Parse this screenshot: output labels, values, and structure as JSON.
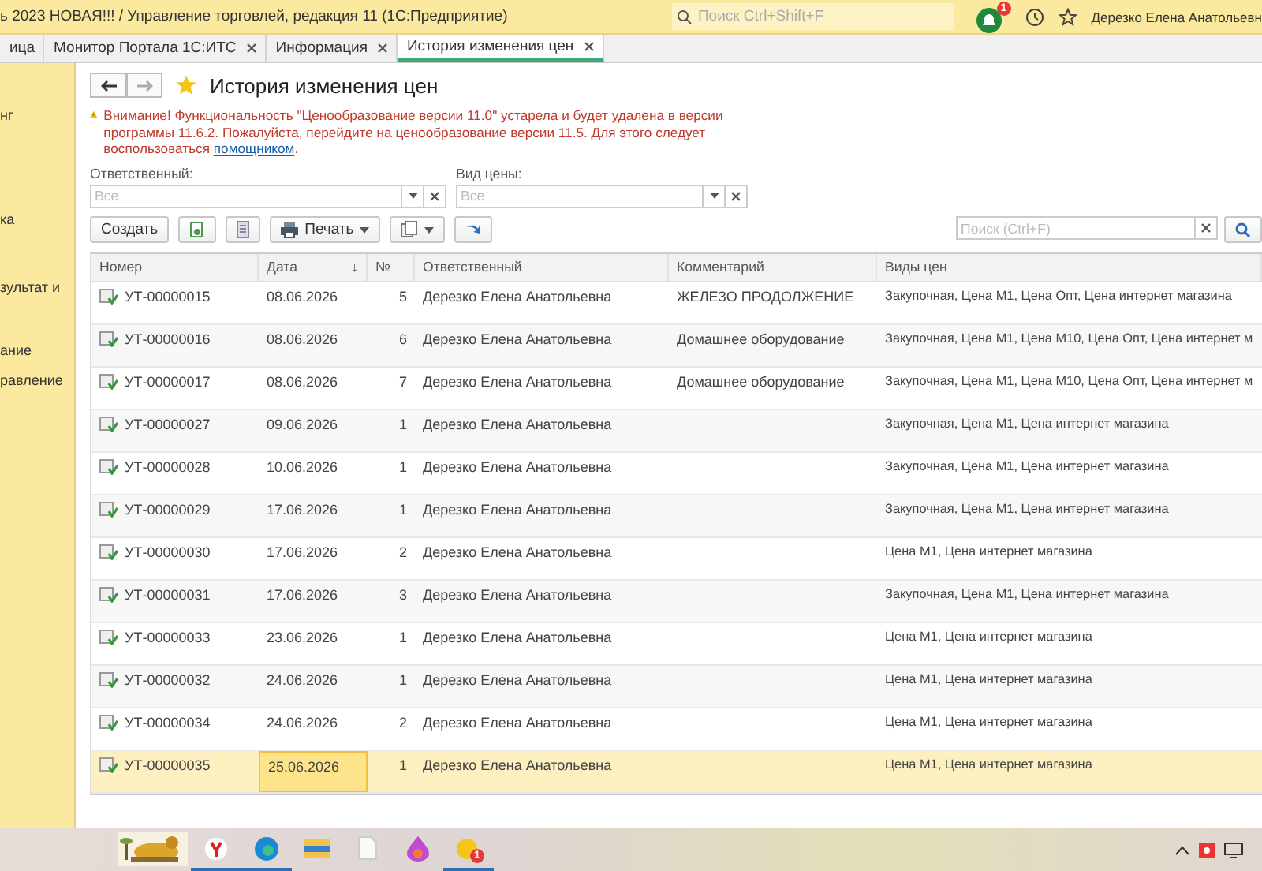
{
  "window": {
    "title": "ь 2023 НОВАЯ!!! / Управление торговлей, редакция 11  (1С:Предприятие)",
    "search_placeholder": "Поиск Ctrl+Shift+F",
    "notifications": "1",
    "user": "Дерезко Елена Анатольевн"
  },
  "tabs": [
    {
      "label": "ица",
      "closable": false,
      "selected": false
    },
    {
      "label": "Монитор Портала 1С:ИТС",
      "closable": true,
      "selected": false
    },
    {
      "label": "Информация",
      "closable": true,
      "selected": false
    },
    {
      "label": "История изменения цен",
      "closable": true,
      "selected": true
    }
  ],
  "sidebar": {
    "items": [
      "нг",
      "ка",
      "зультат и",
      "ание",
      "равление"
    ]
  },
  "page": {
    "title": "История изменения цен",
    "warning": "Внимание! Функциональность \"Ценообразование версии 11.0\" устарела и будет удалена в версии программы 11.6.2. Пожалуйста, перейдите на ценообразование версии 11.5. Для этого следует воспользоваться ",
    "warning_link": "помощником",
    "warning_end": "."
  },
  "filters": [
    {
      "label": "Ответственный:",
      "placeholder": "Все"
    },
    {
      "label": "Вид цены:",
      "placeholder": "Все"
    }
  ],
  "toolbar": {
    "create": "Создать",
    "print": "Печать",
    "search_placeholder": "Поиск (Ctrl+F)"
  },
  "table": {
    "columns": [
      {
        "label": "Номер"
      },
      {
        "label": "Дата",
        "sort_mark": "↓"
      },
      {
        "label": "№"
      },
      {
        "label": "Ответственный"
      },
      {
        "label": "Комментарий"
      },
      {
        "label": "Виды цен"
      }
    ],
    "rows": [
      {
        "number": "УТ-00000015",
        "date": "08.06.2026",
        "n": "5",
        "responsible": "Дерезко Елена Анатольевна",
        "comment": "ЖЕЛЕЗО ПРОДОЛЖЕНИЕ",
        "prices": "Закупочная, Цена М1, Цена Опт, Цена интернет магазина",
        "selected": false
      },
      {
        "number": "УТ-00000016",
        "date": "08.06.2026",
        "n": "6",
        "responsible": "Дерезко Елена Анатольевна",
        "comment": "Домашнее оборудование",
        "prices": "Закупочная, Цена М1, Цена М10, Цена Опт, Цена интернет м",
        "selected": false
      },
      {
        "number": "УТ-00000017",
        "date": "08.06.2026",
        "n": "7",
        "responsible": "Дерезко Елена Анатольевна",
        "comment": "Домашнее оборудование",
        "prices": "Закупочная, Цена М1, Цена М10, Цена Опт, Цена интернет м",
        "selected": false
      },
      {
        "number": "УТ-00000027",
        "date": "09.06.2026",
        "n": "1",
        "responsible": "Дерезко Елена Анатольевна",
        "comment": "",
        "prices": "Закупочная, Цена М1, Цена интернет магазина",
        "selected": false
      },
      {
        "number": "УТ-00000028",
        "date": "10.06.2026",
        "n": "1",
        "responsible": "Дерезко Елена Анатольевна",
        "comment": "",
        "prices": "Закупочная, Цена М1, Цена интернет магазина",
        "selected": false
      },
      {
        "number": "УТ-00000029",
        "date": "17.06.2026",
        "n": "1",
        "responsible": "Дерезко Елена Анатольевна",
        "comment": "",
        "prices": "Закупочная, Цена М1, Цена интернет магазина",
        "selected": false
      },
      {
        "number": "УТ-00000030",
        "date": "17.06.2026",
        "n": "2",
        "responsible": "Дерезко Елена Анатольевна",
        "comment": "",
        "prices": "Цена М1, Цена интернет магазина",
        "selected": false
      },
      {
        "number": "УТ-00000031",
        "date": "17.06.2026",
        "n": "3",
        "responsible": "Дерезко Елена Анатольевна",
        "comment": "",
        "prices": "Закупочная, Цена М1, Цена интернет магазина",
        "selected": false
      },
      {
        "number": "УТ-00000033",
        "date": "23.06.2026",
        "n": "1",
        "responsible": "Дерезко Елена Анатольевна",
        "comment": "",
        "prices": "Цена М1, Цена интернет магазина",
        "selected": false
      },
      {
        "number": "УТ-00000032",
        "date": "24.06.2026",
        "n": "1",
        "responsible": "Дерезко Елена Анатольевна",
        "comment": "",
        "prices": "Цена М1, Цена интернет магазина",
        "selected": false
      },
      {
        "number": "УТ-00000034",
        "date": "24.06.2026",
        "n": "2",
        "responsible": "Дерезко Елена Анатольевна",
        "comment": "",
        "prices": "Цена М1, Цена интернет магазина",
        "selected": false
      },
      {
        "number": "УТ-00000035",
        "date": "25.06.2026",
        "n": "1",
        "responsible": "Дерезко Елена Анатольевна",
        "comment": "",
        "prices": "Цена М1, Цена интернет магазина",
        "selected": true
      }
    ]
  },
  "taskbar": {
    "items": [
      {
        "kind": "picture",
        "active": false
      },
      {
        "kind": "browser",
        "active": true
      },
      {
        "kind": "edge",
        "active": true
      },
      {
        "kind": "folder",
        "active": false
      },
      {
        "kind": "file",
        "active": false
      },
      {
        "kind": "drop",
        "active": false
      },
      {
        "kind": "onec",
        "active": true
      }
    ],
    "badge": "1"
  }
}
